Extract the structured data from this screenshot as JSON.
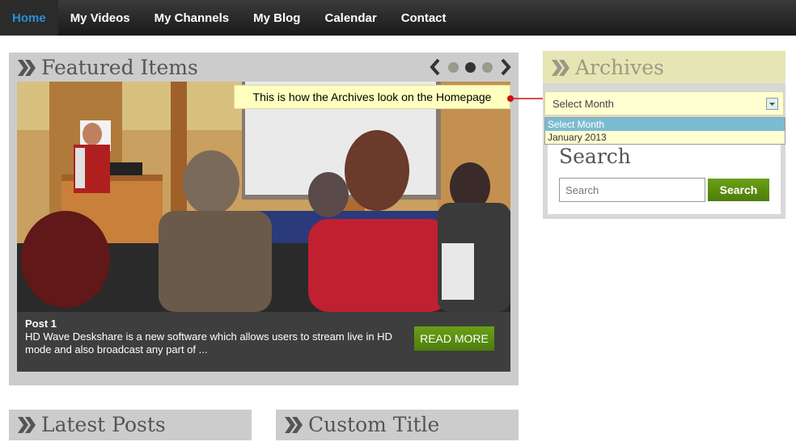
{
  "nav": {
    "items": [
      {
        "label": "Home",
        "active": true
      },
      {
        "label": "My Videos"
      },
      {
        "label": "My Channels"
      },
      {
        "label": "My Blog"
      },
      {
        "label": "Calendar"
      },
      {
        "label": "Contact"
      }
    ]
  },
  "featured": {
    "title": "Featured Items",
    "active_slide": 2,
    "slide_count": 3,
    "post": {
      "title": "Post 1",
      "excerpt": "HD Wave Deskshare is a new software which allows users to stream live in HD mode and also broadcast any part of ...",
      "read_more": "READ MORE"
    }
  },
  "tooltip": {
    "text": "This is how the Archives look on the Homepage"
  },
  "archives": {
    "title": "Archives",
    "select_value": "Select Month",
    "options": [
      "Select Month",
      "January 2013"
    ],
    "highlighted_option": "Select Month"
  },
  "search": {
    "title": "Search",
    "placeholder": "Search",
    "button": "Search"
  },
  "latest": {
    "title": "Latest Posts"
  },
  "custom": {
    "title": "Custom Title"
  },
  "colors": {
    "accent_blue": "#2a8fd6",
    "button_green": "#5b8e12",
    "tooltip_yellow": "#ffffc0",
    "panel_grey": "#cccccc"
  }
}
